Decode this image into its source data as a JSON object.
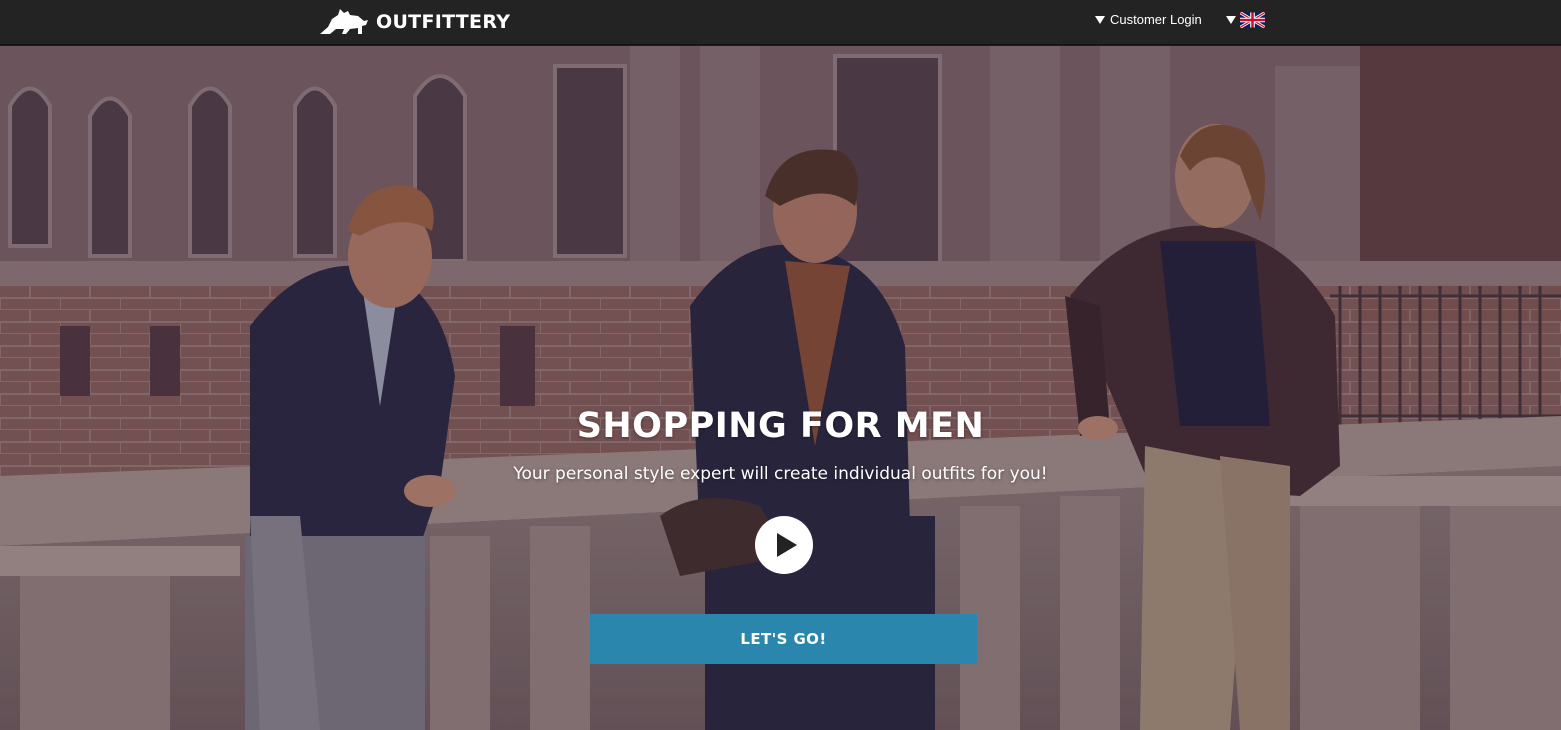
{
  "nav": {
    "brand": "OUTFITTERY",
    "customer_login": "Customer Login",
    "language_icon": "uk-flag-icon",
    "dropdown_icon": "triangle-down-icon"
  },
  "hero": {
    "title": "SHOPPING FOR MEN",
    "subtitle": "Your personal style expert will create individual outfits for you!",
    "play_icon": "play-icon",
    "cta_label": "LET'S GO!"
  },
  "colors": {
    "topbar": "#232323",
    "cta": "#2a86ad",
    "text": "#ffffff"
  }
}
